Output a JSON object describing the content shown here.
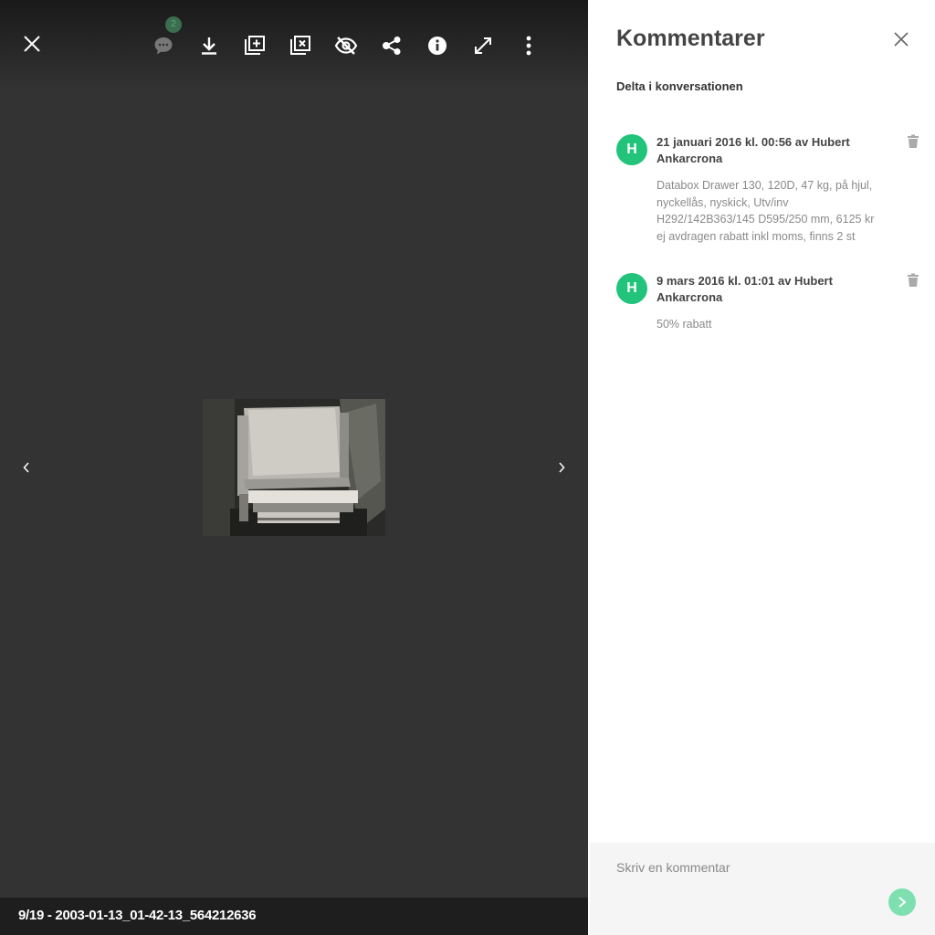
{
  "viewer": {
    "comment_count": "2",
    "caption": "9/19 - 2003-01-13_01-42-13_564212636",
    "photo_alt": "photo"
  },
  "panel": {
    "title": "Kommentarer",
    "subtitle": "Delta i konversationen",
    "comments": [
      {
        "avatar": "H",
        "meta": "21 januari 2016 kl. 00:56 av Hubert Ankarcrona",
        "text": "Databox Drawer 130, 120D, 47 kg, på hjul, nyckellås, nyskick, Utv/inv H292/142B363/145 D595/250 mm, 6125 kr ej avdragen rabatt inkl moms, finns 2 st"
      },
      {
        "avatar": "H",
        "meta": "9 mars 2016 kl. 01:01 av Hubert Ankarcrona",
        "text": "50% rabatt"
      }
    ],
    "composer_placeholder": "Skriv en kommentar"
  },
  "colors": {
    "viewer_bg": "#333333",
    "avatar": "#21c47a",
    "send_button": "#7ee0b1"
  },
  "icons": {
    "toolbar": [
      "close-icon",
      "comment-icon",
      "download-icon",
      "add-to-album-icon",
      "remove-from-album-icon",
      "hide-icon",
      "share-icon",
      "info-icon",
      "fullscreen-icon",
      "more-icon"
    ]
  }
}
